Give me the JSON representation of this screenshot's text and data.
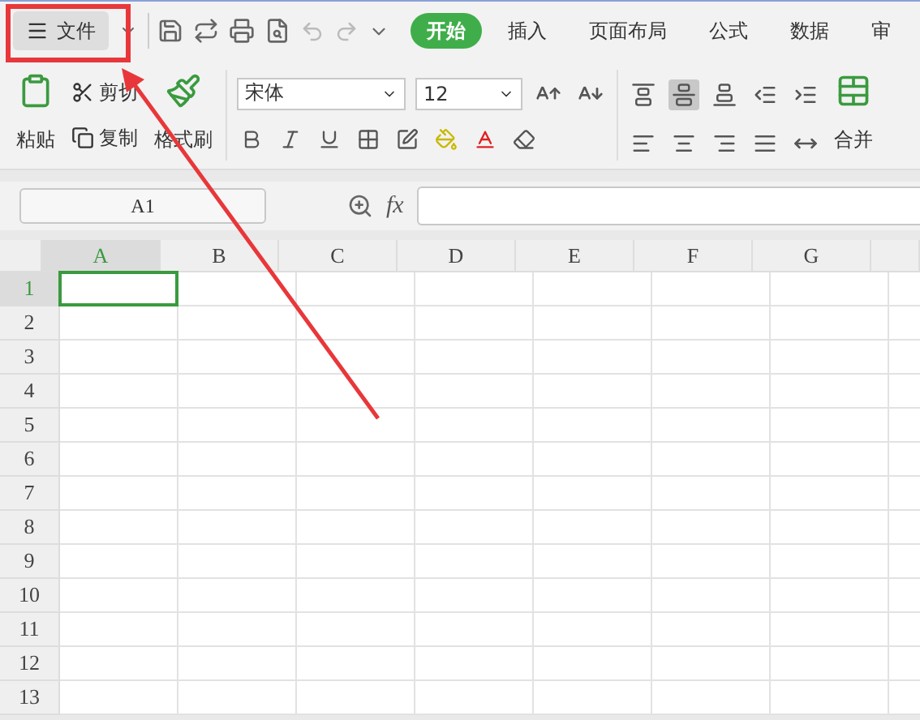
{
  "toolbar": {
    "file_menu": "文件",
    "tabs": [
      {
        "label": "开始",
        "selected": true
      },
      {
        "label": "插入",
        "selected": false
      },
      {
        "label": "页面布局",
        "selected": false
      },
      {
        "label": "公式",
        "selected": false
      },
      {
        "label": "数据",
        "selected": false
      },
      {
        "label": "审",
        "selected": false
      }
    ]
  },
  "ribbon": {
    "paste": "粘贴",
    "cut": "剪切",
    "copy": "复制",
    "format_painter": "格式刷",
    "font_name": "宋体",
    "font_size": "12",
    "alignment": [
      {
        "selected": false
      },
      {
        "selected": true
      },
      {
        "selected": false
      },
      {
        "selected": false
      },
      {
        "selected": false
      },
      {
        "selected": false
      },
      {
        "selected": false
      },
      {
        "selected": false
      },
      {
        "selected": false
      },
      {
        "selected": false
      }
    ],
    "merge": "合并"
  },
  "formula_bar": {
    "name_box": "A1",
    "function_label": "fx"
  },
  "sheet": {
    "columns": [
      {
        "label": "A",
        "selected": true
      },
      {
        "label": "B",
        "selected": false
      },
      {
        "label": "C",
        "selected": false
      },
      {
        "label": "D",
        "selected": false
      },
      {
        "label": "E",
        "selected": false
      },
      {
        "label": "F",
        "selected": false
      },
      {
        "label": "G",
        "selected": false
      }
    ],
    "rows": [
      {
        "label": "1",
        "selected": true
      },
      {
        "label": "2",
        "selected": false
      },
      {
        "label": "3",
        "selected": false
      },
      {
        "label": "4",
        "selected": false
      },
      {
        "label": "5",
        "selected": false
      },
      {
        "label": "6",
        "selected": false
      },
      {
        "label": "7",
        "selected": false
      },
      {
        "label": "8",
        "selected": false
      },
      {
        "label": "9",
        "selected": false
      },
      {
        "label": "10",
        "selected": false
      },
      {
        "label": "11",
        "selected": false
      },
      {
        "label": "12",
        "selected": false
      },
      {
        "label": "13",
        "selected": false
      }
    ]
  }
}
